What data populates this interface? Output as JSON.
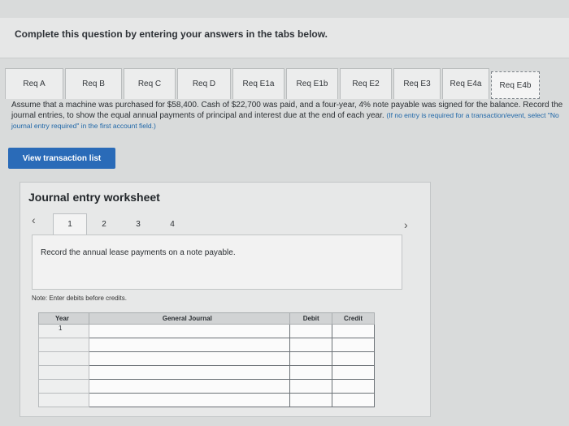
{
  "banner": {
    "text": "Complete this question by entering your answers in the tabs below."
  },
  "tabs": [
    {
      "label": "Req A",
      "w": 72
    },
    {
      "label": "Req B",
      "w": 70
    },
    {
      "label": "Req C",
      "w": 64
    },
    {
      "label": "Req D",
      "w": 66
    },
    {
      "label": "Req E1a",
      "w": 64
    },
    {
      "label": "Req E1b",
      "w": 64
    },
    {
      "label": "Req E2",
      "w": 64
    },
    {
      "label": "Req E3",
      "w": 58
    },
    {
      "label": "Req E4a",
      "w": 58
    },
    {
      "label": "Req E4b",
      "w": 60
    }
  ],
  "question": {
    "main": "Assume that a machine was purchased for $58,400. Cash of $22,700 was paid, and a four-year, 4% note payable was signed for the balance. Record the journal entries, to show the equal annual payments of principal and interest due at the end of each year.",
    "hint": "(If no entry is required for a transaction/event, select \"No journal entry required\" in the first account field.)",
    "hint_prefix": "is required for a transaction/event, select \"No journal entry required\" in the first account field.)"
  },
  "view_button": "View transaction list",
  "worksheet": {
    "title": "Journal entry worksheet",
    "steps": [
      "1",
      "2",
      "3",
      "4"
    ],
    "active_step": "1",
    "instruction": "Record the annual lease payments on a note payable.",
    "note": "Note: Enter debits before credits."
  },
  "journal": {
    "headers": {
      "year": "Year",
      "general_journal": "General Journal",
      "debit": "Debit",
      "credit": "Credit"
    },
    "rows": [
      {
        "year": "1"
      },
      {
        "year": ""
      },
      {
        "year": ""
      },
      {
        "year": ""
      },
      {
        "year": ""
      },
      {
        "year": ""
      }
    ]
  },
  "icons": {
    "prev": "chevron-left-icon",
    "next": "chevron-right-icon"
  }
}
